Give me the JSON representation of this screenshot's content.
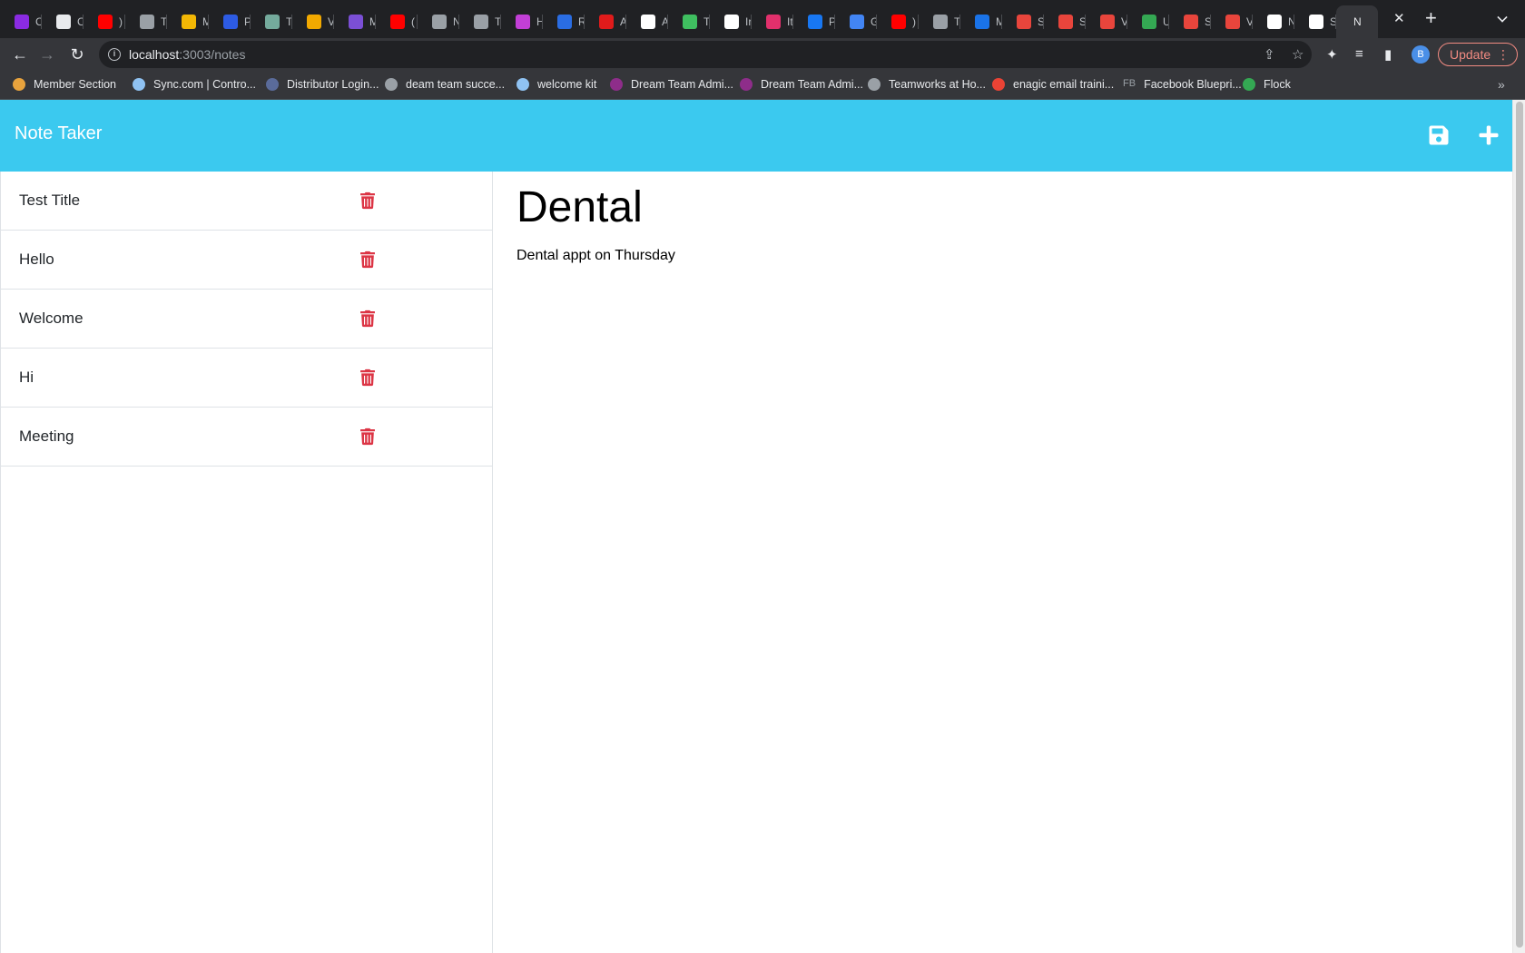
{
  "browser": {
    "tabs": [
      {
        "letter": "C",
        "color": "#8a2be2"
      },
      {
        "letter": "C",
        "color": "#e8eaed"
      },
      {
        "letter": ")",
        "color": "#ff0000"
      },
      {
        "letter": "T",
        "color": "#9aa0a6"
      },
      {
        "letter": "M",
        "color": "#f2b705"
      },
      {
        "letter": "P",
        "color": "#2d5be3"
      },
      {
        "letter": "T",
        "color": "#74aa9c"
      },
      {
        "letter": "V",
        "color": "#f2a900"
      },
      {
        "letter": "M",
        "color": "#7b4fd6"
      },
      {
        "letter": "(",
        "color": "#ff0000"
      },
      {
        "letter": "N",
        "color": "#9aa0a6"
      },
      {
        "letter": "T",
        "color": "#9aa0a6"
      },
      {
        "letter": "H",
        "color": "#c23fd6"
      },
      {
        "letter": "R",
        "color": "#2a6de3"
      },
      {
        "letter": "A",
        "color": "#e01b1b"
      },
      {
        "letter": "A",
        "color": "#ffffff"
      },
      {
        "letter": "T",
        "color": "#3fbf60"
      },
      {
        "letter": "Ir",
        "color": "#ffffff"
      },
      {
        "letter": "It",
        "color": "#e1306c"
      },
      {
        "letter": "P",
        "color": "#1877f2"
      },
      {
        "letter": "G",
        "color": "#4285f4"
      },
      {
        "letter": ")",
        "color": "#ff0000"
      },
      {
        "letter": "T",
        "color": "#9aa0a6"
      },
      {
        "letter": "M",
        "color": "#1a73e8"
      },
      {
        "letter": "S",
        "color": "#e8453c"
      },
      {
        "letter": "S",
        "color": "#e8453c"
      },
      {
        "letter": "V",
        "color": "#e8453c"
      },
      {
        "letter": "U",
        "color": "#34a853"
      },
      {
        "letter": "S",
        "color": "#e8453c"
      },
      {
        "letter": "V",
        "color": "#e8453c"
      },
      {
        "letter": "N",
        "color": "#ffffff"
      },
      {
        "letter": "S",
        "color": "#ffffff"
      }
    ],
    "active_tab_letter": "N",
    "url_host": "localhost",
    "url_path": ":3003/notes",
    "profile_initial": "B",
    "update_label": "Update",
    "bookmarks": [
      {
        "label": "Member Section",
        "color": "#e8a33d"
      },
      {
        "label": "Sync.com | Contro...",
        "color": "#8fc2f2"
      },
      {
        "label": "Distributor Login...",
        "color": "#5a6b9a"
      },
      {
        "label": "deam team succe...",
        "color": "#9aa0a6"
      },
      {
        "label": "welcome kit",
        "color": "#8fc2f2"
      },
      {
        "label": "Dream Team Admi...",
        "color": "#8e2d8a"
      },
      {
        "label": "Dream Team Admi...",
        "color": "#8e2d8a"
      },
      {
        "label": "Teamworks at Ho...",
        "color": "#9aa0a6"
      },
      {
        "label": "enagic email traini...",
        "color": "#ea4335"
      },
      {
        "label": "Facebook Bluepri...",
        "color": "#5f6368",
        "prefix": "FB"
      },
      {
        "label": "Flock",
        "color": "#34a853"
      }
    ]
  },
  "app": {
    "brand": "Note Taker",
    "notes": [
      {
        "title": "Test Title"
      },
      {
        "title": "Hello"
      },
      {
        "title": "Welcome"
      },
      {
        "title": "Hi"
      },
      {
        "title": "Meeting"
      }
    ],
    "active_note": {
      "title": "Dental",
      "text": "Dental appt on Thursday"
    },
    "colors": {
      "navbar": "#3bc9ef",
      "trash": "#dc3545"
    },
    "icons": {
      "save": "save-icon",
      "add": "plus-icon",
      "delete": "trash-icon"
    }
  }
}
